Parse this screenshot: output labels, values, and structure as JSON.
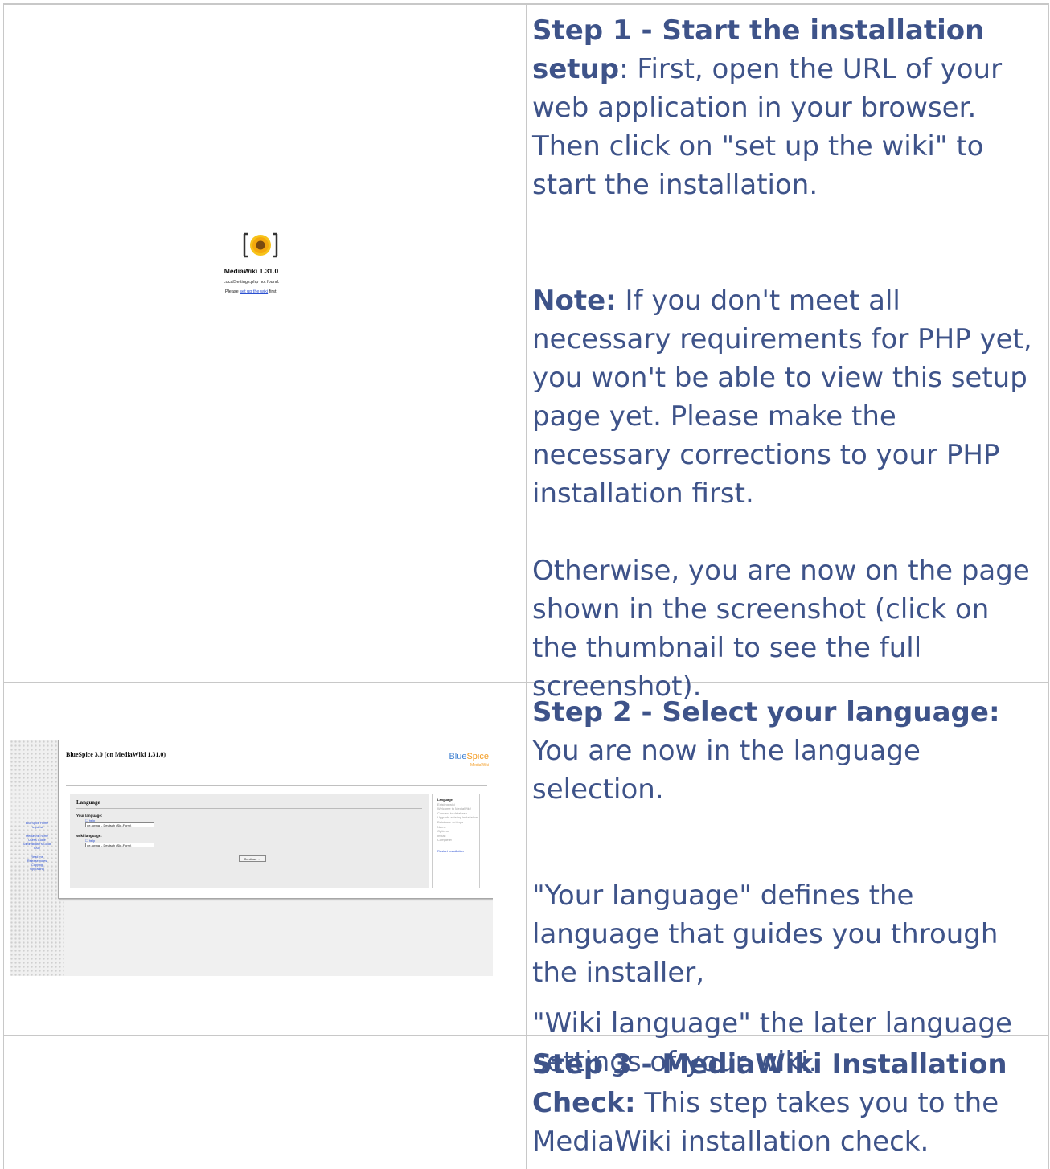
{
  "rows": [
    {
      "title": "Step 1 - Start the installation setup",
      "intro": ": First, open the URL of your web application in your browser. Then click on \"set up the wiki\" to start the installation.",
      "note_label": "Note:",
      "note": " If you don't meet all necessary requirements for PHP yet, you won't be able to view this setup page yet. Please make the necessary corrections to your PHP installation first.",
      "para": "Otherwise, you are now on the page shown in the screenshot (click on the thumbnail to see the full screenshot).",
      "thumb": {
        "title": "MediaWiki 1.31.0",
        "line1": "LocalSettings.php not found.",
        "line2_pre": "Please ",
        "line2_link": "set up the wiki",
        "line2_post": " first."
      }
    },
    {
      "title": "Step 2 - Select your language:",
      "intro": " You are now in the language selection.",
      "para1": "\"Your language\" defines the language that guides you through the installer,",
      "para2": "\"Wiki language\" the later language settings of your wiki.",
      "thumb": {
        "title": "BlueSpice 3.0 (on MediaWiki 1.31.0)",
        "brand_a": "Blue",
        "brand_b": "Spice",
        "brand_sub": "MediaWiki",
        "section": "Language",
        "your_language": "Your language:",
        "wiki_language": "Wiki language:",
        "help": "☐ help",
        "select_value": "de-formal - Deutsch (Sie-Form)",
        "continue": "Continue →",
        "steps": [
          "Language",
          "Existing wiki",
          "Welcome to MediaWiki!",
          "Connect to database",
          "Upgrade existing installation",
          "Database settings",
          "Name",
          "Options",
          "Install",
          "Complete!"
        ],
        "restart": "Restart installation",
        "nav": [
          "BlueSpice Home",
          "Helpdesk",
          "",
          "MediaWiki home",
          "User's Guide",
          "Administrator's Guide",
          "FAQ",
          "",
          "Read me",
          "Release notes",
          "Copying",
          "Upgrading"
        ]
      }
    },
    {
      "title": "Step 3 - MediaWiki Installation Check:",
      "intro": " This step takes you to the MediaWiki installation check."
    }
  ]
}
